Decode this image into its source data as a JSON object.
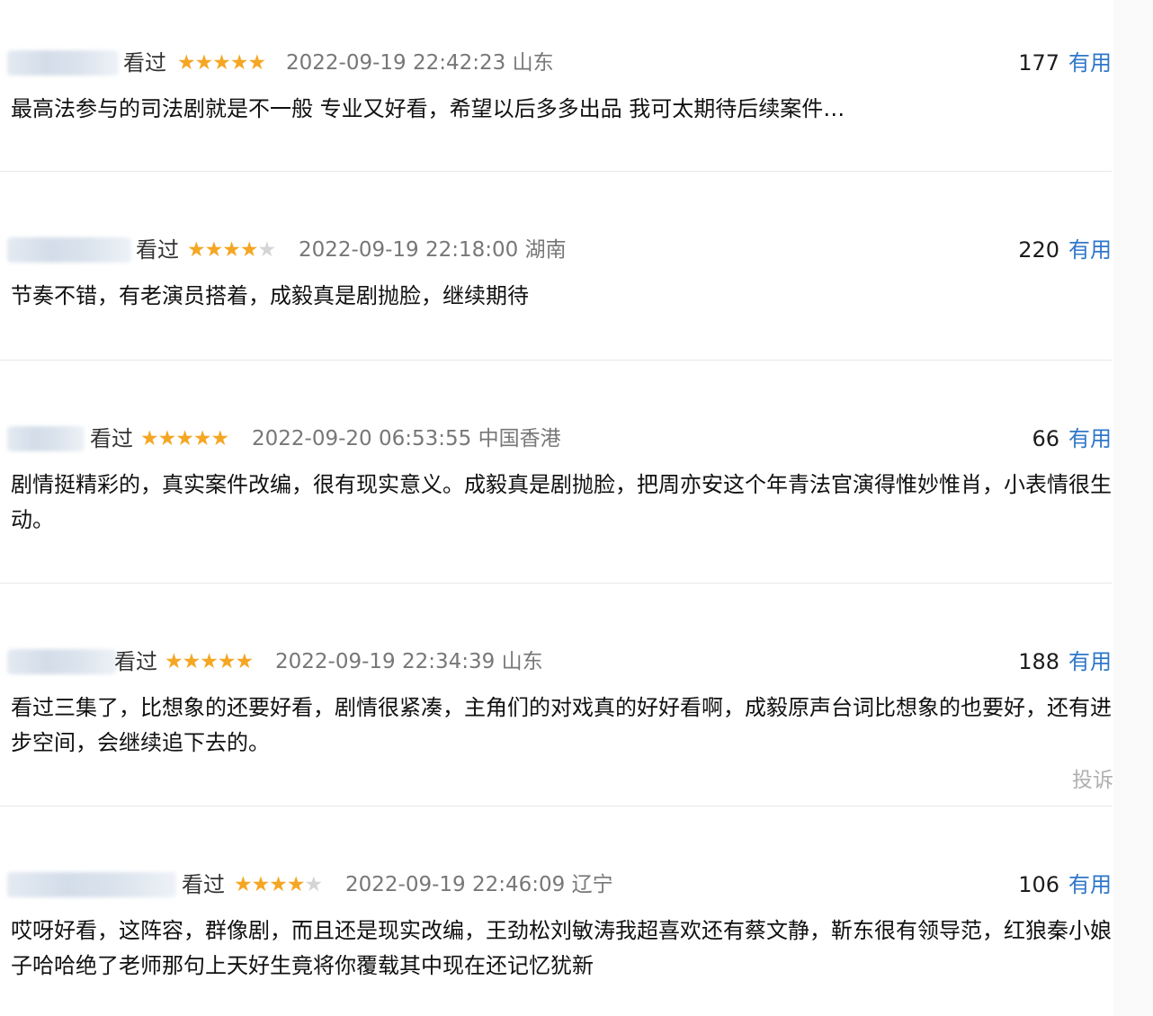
{
  "reviews": [
    {
      "status": "看过",
      "stars": 5,
      "time": "2022-09-19 22:42:23",
      "location": "山东",
      "useful_count": "177",
      "useful_label": "有用",
      "content": "最高法参与的司法剧就是不一般 专业又好看，希望以后多多出品 我可太期待后续案件…"
    },
    {
      "status": "看过",
      "stars": 4,
      "time": "2022-09-19 22:18:00",
      "location": "湖南",
      "useful_count": "220",
      "useful_label": "有用",
      "content": "节奏不错，有老演员搭着，成毅真是剧抛脸，继续期待"
    },
    {
      "status": "看过",
      "stars": 5,
      "time": "2022-09-20 06:53:55",
      "location": "中国香港",
      "useful_count": "66",
      "useful_label": "有用",
      "content": "剧情挺精彩的，真实案件改编，很有现实意义。成毅真是剧抛脸，把周亦安这个年青法官演得惟妙惟肖，小表情很生动。"
    },
    {
      "status": "看过",
      "stars": 5,
      "time": "2022-09-19 22:34:39",
      "location": "山东",
      "useful_count": "188",
      "useful_label": "有用",
      "content": "看过三集了，比想象的还要好看，剧情很紧凑，主角们的对戏真的好好看啊，成毅原声台词比想象的也要好，还有进步空间，会继续追下去的。",
      "report_label": "投诉"
    },
    {
      "status": "看过",
      "stars": 4,
      "time": "2022-09-19 22:46:09",
      "location": "辽宁",
      "useful_count": "106",
      "useful_label": "有用",
      "content": "哎呀好看，这阵容，群像剧，而且还是现实改编，王劲松刘敏涛我超喜欢还有蔡文静，靳东很有领导范，红狼秦小娘子哈哈绝了老师那句上天好生竟将你覆载其中现在还记忆犹新"
    }
  ],
  "colors": {
    "star": "#f5a623",
    "star_empty": "#d5d5d5",
    "useful_link": "#2f77c9",
    "meta_text": "#777777"
  },
  "icons": {
    "star_filled": "star-filled-icon",
    "star_empty": "star-empty-icon"
  }
}
